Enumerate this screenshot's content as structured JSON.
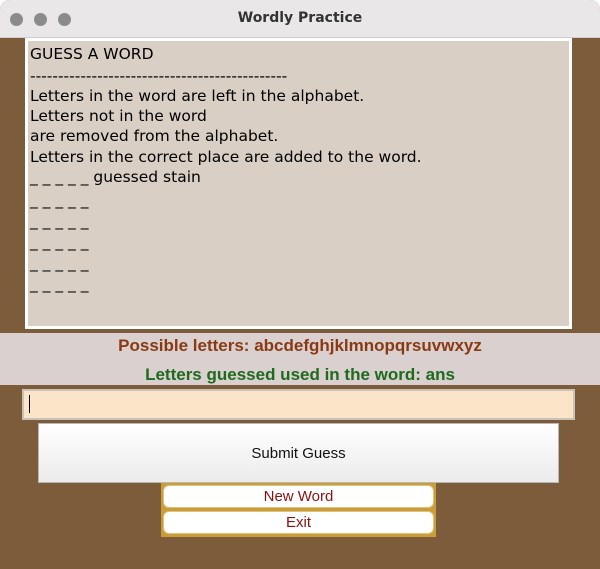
{
  "window": {
    "title": "Wordly Practice"
  },
  "text_area": {
    "lines": [
      "GUESS A WORD",
      "----------------------------------------------",
      "Letters in the word are left in the alphabet.",
      "Letters not in the word",
      "are removed from the alphabet.",
      "Letters in the correct place are added to the word.",
      "_ _ _ _ _ guessed stain",
      "_ _ _ _ _",
      "_ _ _ _ _",
      "_ _ _ _ _",
      "_ _ _ _ _",
      "_ _ _ _ _"
    ]
  },
  "info": {
    "possible_letters": "Possible letters: abcdefghjklmnopqrsuvwxyz",
    "letters_guessed": "Letters guessed used in the word: ans"
  },
  "guess_input": {
    "value": ""
  },
  "buttons": {
    "submit": "Submit Guess",
    "new_word": "New Word",
    "exit": "Exit"
  },
  "colors": {
    "background": "#7d5c3c",
    "text_area": "#d9cfc4",
    "possible_letters": "#8a3a12",
    "letters_guessed": "#1e6b1e",
    "input": "#fce4c8",
    "button_frame": "#c99e3a",
    "small_button_text": "#8a1010"
  }
}
